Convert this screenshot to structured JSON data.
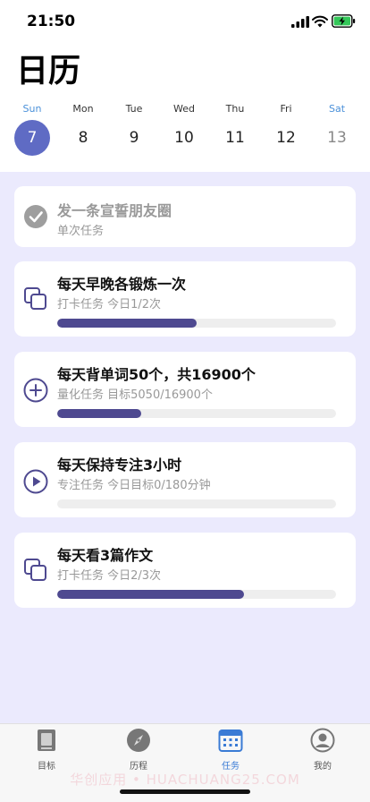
{
  "status": {
    "time": "21:50"
  },
  "title": "日历",
  "colors": {
    "accent": "#5f6bc4",
    "progress": "#4e4990",
    "taskBg": "#ebeafd",
    "tabActive": "#3a7bd5"
  },
  "week": [
    {
      "name": "Sun",
      "num": "7",
      "selected": true,
      "weekend": true
    },
    {
      "name": "Mon",
      "num": "8"
    },
    {
      "name": "Tue",
      "num": "9"
    },
    {
      "name": "Wed",
      "num": "10"
    },
    {
      "name": "Thu",
      "num": "11"
    },
    {
      "name": "Fri",
      "num": "12"
    },
    {
      "name": "Sat",
      "num": "13",
      "weekend": true
    }
  ],
  "tasks": [
    {
      "icon": "check-circle-icon",
      "title": "发一条宣誓朋友圈",
      "sub": "单次任务",
      "done": true,
      "progress": null
    },
    {
      "icon": "copy-icon",
      "title": "每天早晚各锻炼一次",
      "sub": "打卡任务 今日1/2次",
      "done": false,
      "progress": 0.5
    },
    {
      "icon": "plus-circle-icon",
      "title": "每天背单词50个，共16900个",
      "sub": "量化任务 目标5050/16900个",
      "done": false,
      "progress": 0.3
    },
    {
      "icon": "play-circle-icon",
      "title": "每天保持专注3小时",
      "sub": "专注任务 今日目标0/180分钟",
      "done": false,
      "progress": 0.0
    },
    {
      "icon": "copy-icon",
      "title": "每天看3篇作文",
      "sub": "打卡任务 今日2/3次",
      "done": false,
      "progress": 0.67
    }
  ],
  "tabs": [
    {
      "label": "目标",
      "icon": "target-book-icon"
    },
    {
      "label": "历程",
      "icon": "compass-icon"
    },
    {
      "label": "任务",
      "icon": "calendar-icon",
      "active": true
    },
    {
      "label": "我的",
      "icon": "profile-icon"
    }
  ],
  "watermark": "华创应用 • HUACHUANG25.COM"
}
